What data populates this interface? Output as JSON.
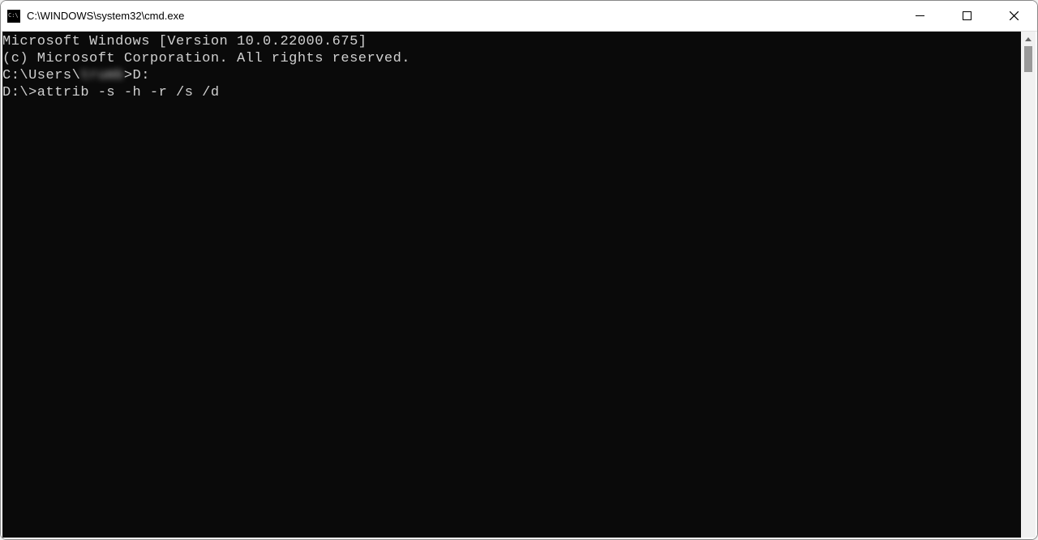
{
  "titlebar": {
    "title": "C:\\WINDOWS\\system32\\cmd.exe"
  },
  "terminal": {
    "line1": "Microsoft Windows [Version 10.0.22000.675]",
    "line2": "(c) Microsoft Corporation. All rights reserved.",
    "blank1": "",
    "prompt1_prefix": "C:\\Users\\",
    "prompt1_user": "trumb",
    "prompt1_cmd": ">D:",
    "blank2": "",
    "prompt2": "D:\\>attrib -s -h -r /s /d"
  }
}
